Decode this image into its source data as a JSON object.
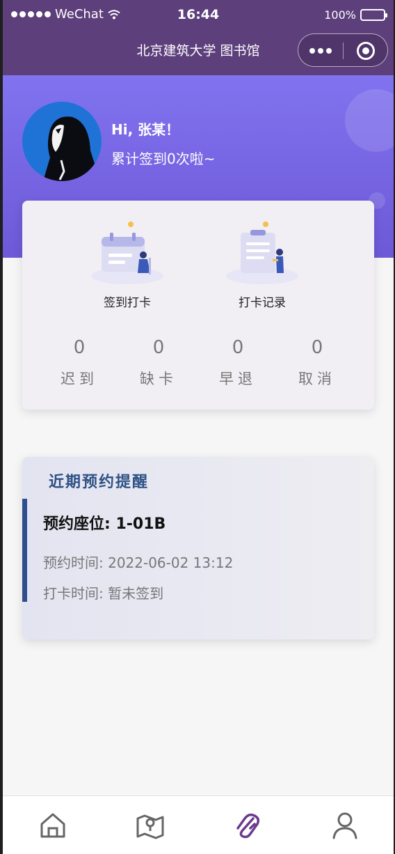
{
  "status_bar": {
    "carrier": "WeChat",
    "time": "16:44",
    "battery": "100%"
  },
  "nav": {
    "title": "北京建筑大学 图书馆"
  },
  "user": {
    "greeting": "Hi, 张某！",
    "checkin_count_text": "累计签到0次啦~"
  },
  "actions": [
    {
      "label": "签到打卡",
      "icon": "calendar-illustration"
    },
    {
      "label": "打卡记录",
      "icon": "clipboard-illustration"
    }
  ],
  "stats": [
    {
      "value": "0",
      "label": "迟到"
    },
    {
      "value": "0",
      "label": "缺卡"
    },
    {
      "value": "0",
      "label": "早退"
    },
    {
      "value": "0",
      "label": "取消"
    }
  ],
  "reminder": {
    "title": "近期预约提醒",
    "seat": "预约座位: 1-01B",
    "reserve_time": "预约时间: 2022-06-02 13:12",
    "checkin_time": "打卡时间: 暂未签到"
  },
  "tabs": [
    {
      "icon": "home-icon",
      "active": false
    },
    {
      "icon": "map-icon",
      "active": false
    },
    {
      "icon": "paperclip-icon",
      "active": true
    },
    {
      "icon": "user-icon",
      "active": false
    }
  ],
  "colors": {
    "header_bg": "#5d3f7c",
    "hero_gradient_top": "#8173ef",
    "hero_gradient_bottom": "#6d59d7",
    "reminder_title": "#2e5184",
    "tab_active": "#6b3a8e",
    "tab_inactive": "#666666"
  }
}
